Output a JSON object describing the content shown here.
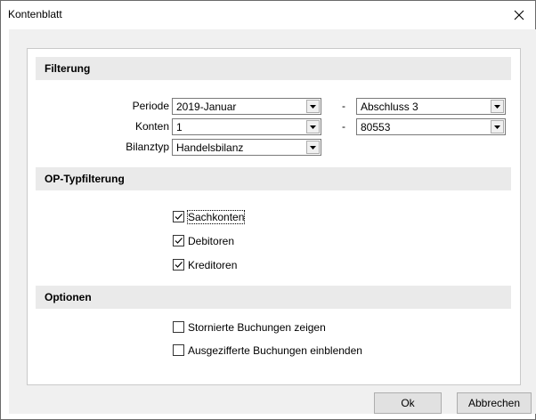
{
  "window": {
    "title": "Kontenblatt"
  },
  "sections": {
    "filter": "Filterung",
    "op_filter": "OP-Typfilterung",
    "options": "Optionen"
  },
  "filter": {
    "periode_label": "Periode",
    "periode_from": "2019-Januar",
    "periode_to": "Abschluss 3",
    "konten_label": "Konten",
    "konten_from": "1",
    "konten_to": "80553",
    "bilanztyp_label": "Bilanztyp",
    "bilanztyp": "Handelsbilanz",
    "range_separator": "-"
  },
  "op_filter": {
    "sachkonten": {
      "label": "Sachkonten",
      "checked": true
    },
    "debitoren": {
      "label": "Debitoren",
      "checked": true
    },
    "kreditoren": {
      "label": "Kreditoren",
      "checked": true
    }
  },
  "options": {
    "storniert": {
      "label": "Stornierte Buchungen zeigen",
      "checked": false
    },
    "ausgeziffert": {
      "label": "Ausgezifferte Buchungen einblenden",
      "checked": false
    }
  },
  "buttons": {
    "ok": "Ok",
    "cancel": "Abbrechen"
  }
}
